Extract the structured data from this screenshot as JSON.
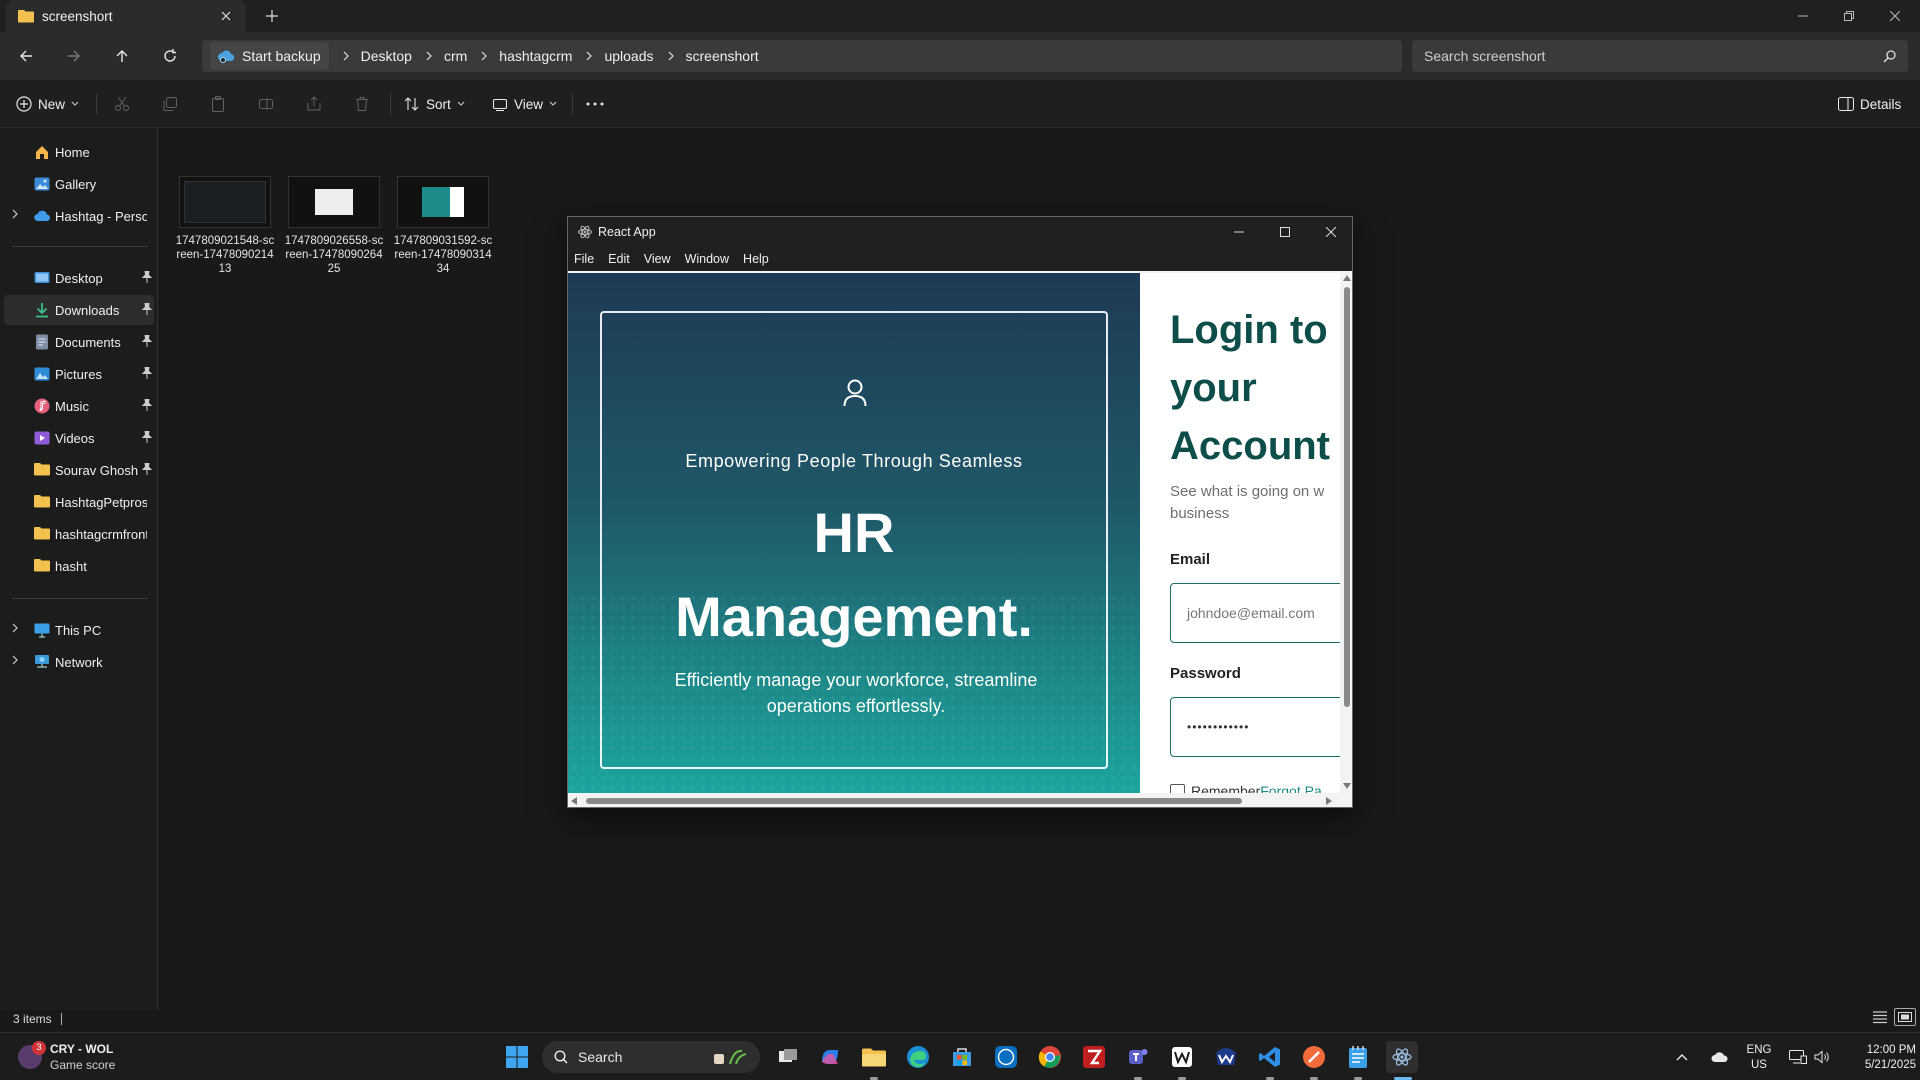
{
  "explorer": {
    "tab_title": "screenshort",
    "breadcrumb": [
      "Start backup",
      "Desktop",
      "crm",
      "hashtagcrm",
      "uploads",
      "screenshort"
    ],
    "search_placeholder": "Search screenshort",
    "commands": {
      "new": "New",
      "sort": "Sort",
      "view": "View",
      "details": "Details"
    },
    "sidebar": {
      "quick": [
        {
          "label": "Home"
        },
        {
          "label": "Gallery"
        },
        {
          "label": "Hashtag - Personal"
        }
      ],
      "pinned": [
        {
          "label": "Desktop"
        },
        {
          "label": "Downloads"
        },
        {
          "label": "Documents"
        },
        {
          "label": "Pictures"
        },
        {
          "label": "Music"
        },
        {
          "label": "Videos"
        },
        {
          "label": "Sourav Ghosh B"
        },
        {
          "label": "HashtagPetpros"
        },
        {
          "label": "hashtagcrmfront"
        },
        {
          "label": "hasht"
        }
      ],
      "system": [
        {
          "label": "This PC"
        },
        {
          "label": "Network"
        }
      ]
    },
    "files": [
      {
        "name": "1747809021548-screen-1747809021413"
      },
      {
        "name": "1747809026558-screen-1747809026425"
      },
      {
        "name": "1747809031592-screen-1747809031434"
      }
    ],
    "status": "3 items"
  },
  "react_app": {
    "title": "React App",
    "menu": [
      "File",
      "Edit",
      "View",
      "Window",
      "Help"
    ],
    "hero": {
      "kicker": "Empowering People Through Seamless",
      "title_line1": "HR",
      "title_line2": "Management.",
      "subtitle": "Efficiently manage your workforce, streamline operations effortlessly."
    },
    "login": {
      "title_line1": "Login to",
      "title_line2": "your",
      "title_line3": "Account",
      "sub_line1": "See what is going on w",
      "sub_line2": "business",
      "email_label": "Email",
      "email_placeholder": "johndoe@email.com",
      "password_label": "Password",
      "password_value": "••••••••••••",
      "remember": "Remember",
      "forgot": "Forgot Pa"
    }
  },
  "taskbar": {
    "widget_title": "CRY - WOL",
    "widget_sub": "Game score",
    "widget_badge": "3",
    "search": "Search",
    "lang": "ENG",
    "region": "US",
    "time": "12:00 PM",
    "date": "5/21/2025"
  },
  "colors": {
    "accent_teal": "#0d4d4a",
    "folder_yellow": "#f2c14e"
  }
}
